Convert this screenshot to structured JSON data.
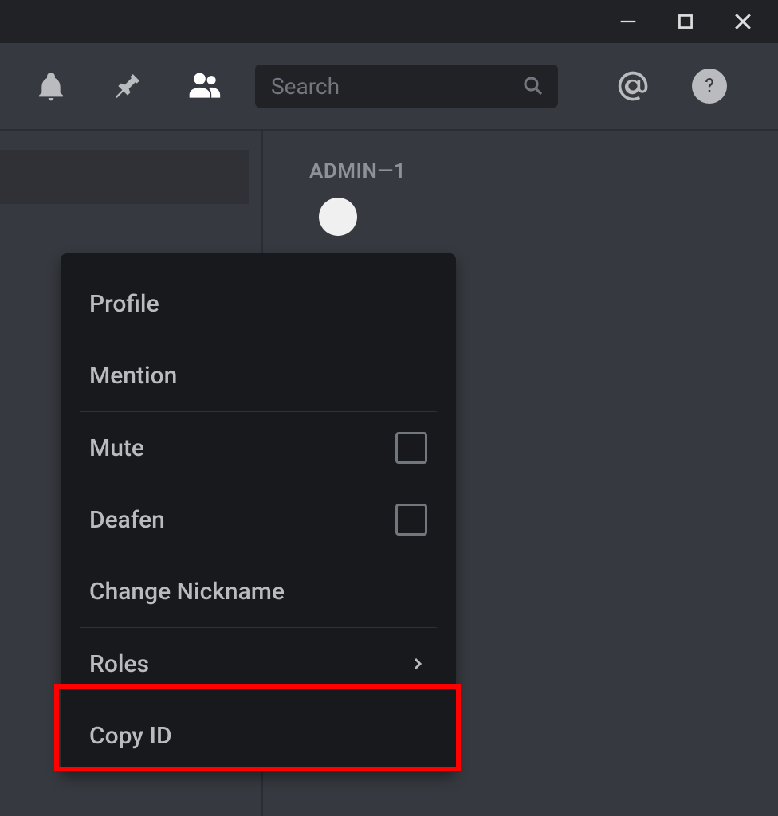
{
  "titlebar": {
    "minimize": "minimize",
    "maximize": "maximize",
    "close": "close"
  },
  "toolbar": {
    "search_placeholder": "Search"
  },
  "main": {
    "role_header": "ADMIN—1"
  },
  "context_menu": {
    "profile": "Profile",
    "mention": "Mention",
    "mute": "Mute",
    "deafen": "Deafen",
    "change_nickname": "Change Nickname",
    "roles": "Roles",
    "copy_id": "Copy ID"
  }
}
